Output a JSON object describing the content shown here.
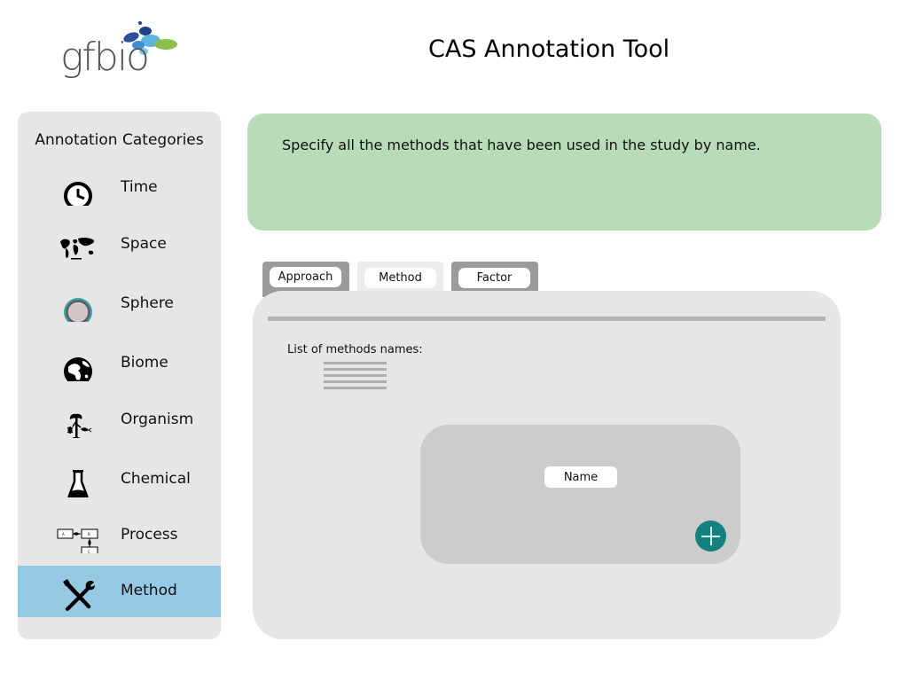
{
  "header": {
    "logo_text": "gfbio",
    "title": "CAS Annotation Tool"
  },
  "sidebar": {
    "title": "Annotation Categories",
    "items": [
      {
        "label": "Time",
        "icon": "clock-icon"
      },
      {
        "label": "Space",
        "icon": "world-map-icon"
      },
      {
        "label": "Sphere",
        "icon": "sphere-icon"
      },
      {
        "label": "Biome",
        "icon": "globe-icon"
      },
      {
        "label": "Organism",
        "icon": "organism-icon"
      },
      {
        "label": "Chemical",
        "icon": "flask-icon"
      },
      {
        "label": "Process",
        "icon": "process-diagram-icon"
      },
      {
        "label": "Method",
        "icon": "tools-icon",
        "active": true
      }
    ]
  },
  "info": {
    "text": "Specify all the methods that have been used in the study by name."
  },
  "tabs": [
    {
      "label": "Approach",
      "active": false
    },
    {
      "label": "Method",
      "active": true
    },
    {
      "label": "Factor",
      "active": false
    }
  ],
  "panel": {
    "list_label": "List of methods names:",
    "name_placeholder": "Name",
    "add_icon": "plus-icon"
  },
  "colors": {
    "active_category": "#96c9e4",
    "info_box": "#b7dcb7",
    "add_button": "#148080",
    "panel": "#e6e6e6"
  }
}
